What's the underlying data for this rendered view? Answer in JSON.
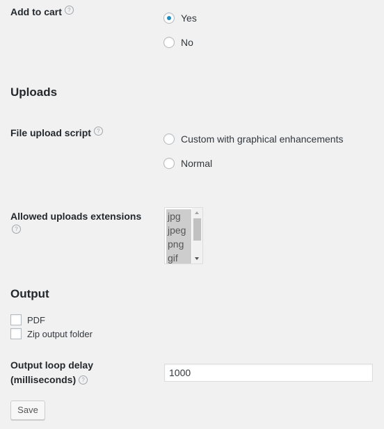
{
  "add_to_cart": {
    "label": "Add to cart",
    "help": "?",
    "options": [
      {
        "label": "Yes",
        "checked": true
      },
      {
        "label": "No",
        "checked": false
      }
    ]
  },
  "uploads": {
    "heading": "Uploads",
    "file_upload_script": {
      "label": "File upload script",
      "help": "?",
      "options": [
        {
          "label": "Custom with graphical enhancements",
          "checked": false
        },
        {
          "label": "Normal",
          "checked": false
        }
      ]
    },
    "allowed_extensions": {
      "label": "Allowed uploads extensions",
      "help": "?",
      "options": [
        "jpg",
        "jpeg",
        "png",
        "gif"
      ]
    }
  },
  "output": {
    "heading": "Output",
    "checkboxes": [
      {
        "label": "PDF",
        "checked": false
      },
      {
        "label": "Zip output folder",
        "checked": false
      }
    ],
    "loop_delay": {
      "label_line1": "Output loop delay",
      "label_line2": "(milliseconds)",
      "help": "?",
      "value": "1000"
    }
  },
  "save_button": "Save",
  "colors": {
    "background": "#f1f1f1",
    "accent": "#1e8cbe",
    "selected_option": "#cdcdcd"
  }
}
